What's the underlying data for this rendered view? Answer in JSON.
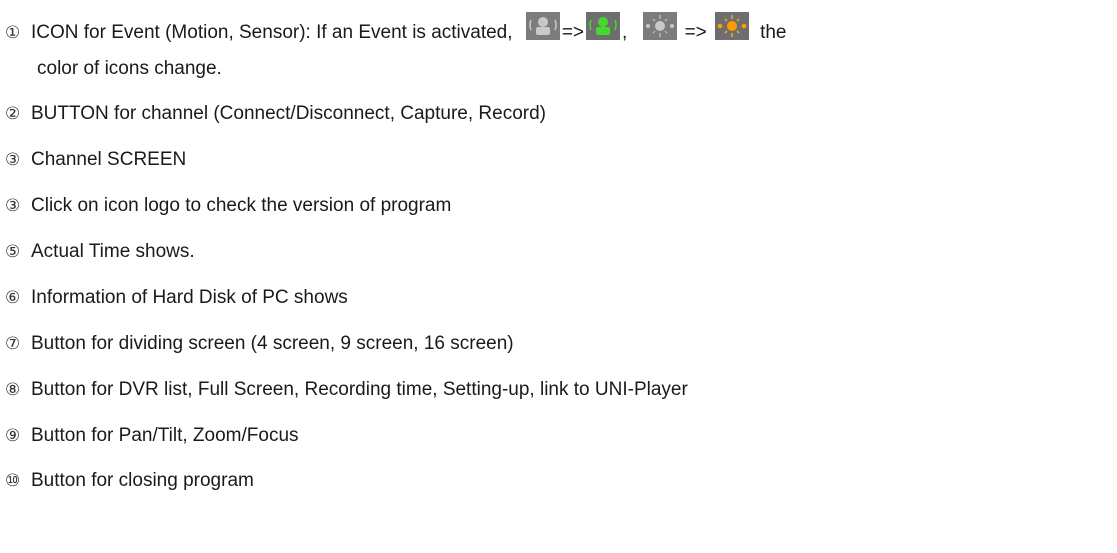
{
  "items": [
    {
      "number": "①",
      "text_before": "ICON for Event (Motion, Sensor):   If an Event is activated,",
      "arrow1": "=>",
      "comma": ",",
      "arrow2": "=>",
      "text_after": "the",
      "continuation": "color of icons change.",
      "icons": [
        "motion-icon-gray",
        "motion-icon-green",
        "sensor-icon-gray",
        "sensor-icon-orange"
      ]
    },
    {
      "number": "②",
      "text": "BUTTON for channel (Connect/Disconnect, Capture, Record)"
    },
    {
      "number": "③",
      "text": "Channel SCREEN"
    },
    {
      "number": "③",
      "text": "Click on icon logo to check the version of program"
    },
    {
      "number": "⑤",
      "text": "Actual Time shows."
    },
    {
      "number": "⑥",
      "text": "Information of Hard Disk of PC shows"
    },
    {
      "number": "⑦",
      "text": "Button for dividing screen (4 screen, 9 screen, 16 screen)"
    },
    {
      "number": "⑧",
      "text": "Button for DVR list, Full Screen, Recording time, Setting-up, link to UNI-Player"
    },
    {
      "number": "⑨",
      "text": "Button for Pan/Tilt, Zoom/Focus"
    },
    {
      "number": "⑩",
      "text": "Button for closing program"
    }
  ],
  "colors": {
    "icon_gray_bg": "#7a7a7a",
    "icon_active_green": "#3fcf2a",
    "icon_active_orange": "#ff9a00"
  }
}
